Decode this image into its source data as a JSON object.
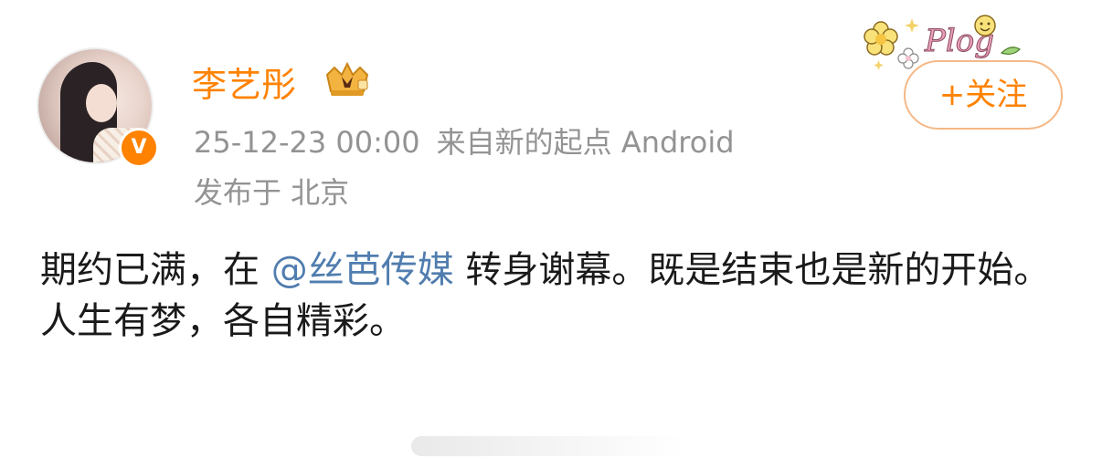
{
  "user": {
    "name": "李艺彤",
    "verified_mark": "V",
    "avatar_icon": "avatar-photo",
    "member_icon": "crown-icon"
  },
  "meta": {
    "time": "25-12-23 00:00",
    "source": "来自新的起点 Android",
    "location": "发布于 北京"
  },
  "follow_button": {
    "label": "+关注"
  },
  "decoration": {
    "text": "Plog",
    "icon": "flower-sticker-icon"
  },
  "post": {
    "line1_before": "期约已满，在 ",
    "mention": "@丝芭传媒",
    "line1_after": " 转身谢幕。既是结束也是新的开始。",
    "line2": "人生有梦，各自精彩。"
  },
  "colors": {
    "accent": "#ff8200",
    "mention": "#507daf",
    "meta": "#939393",
    "text": "#1a1a1a"
  }
}
